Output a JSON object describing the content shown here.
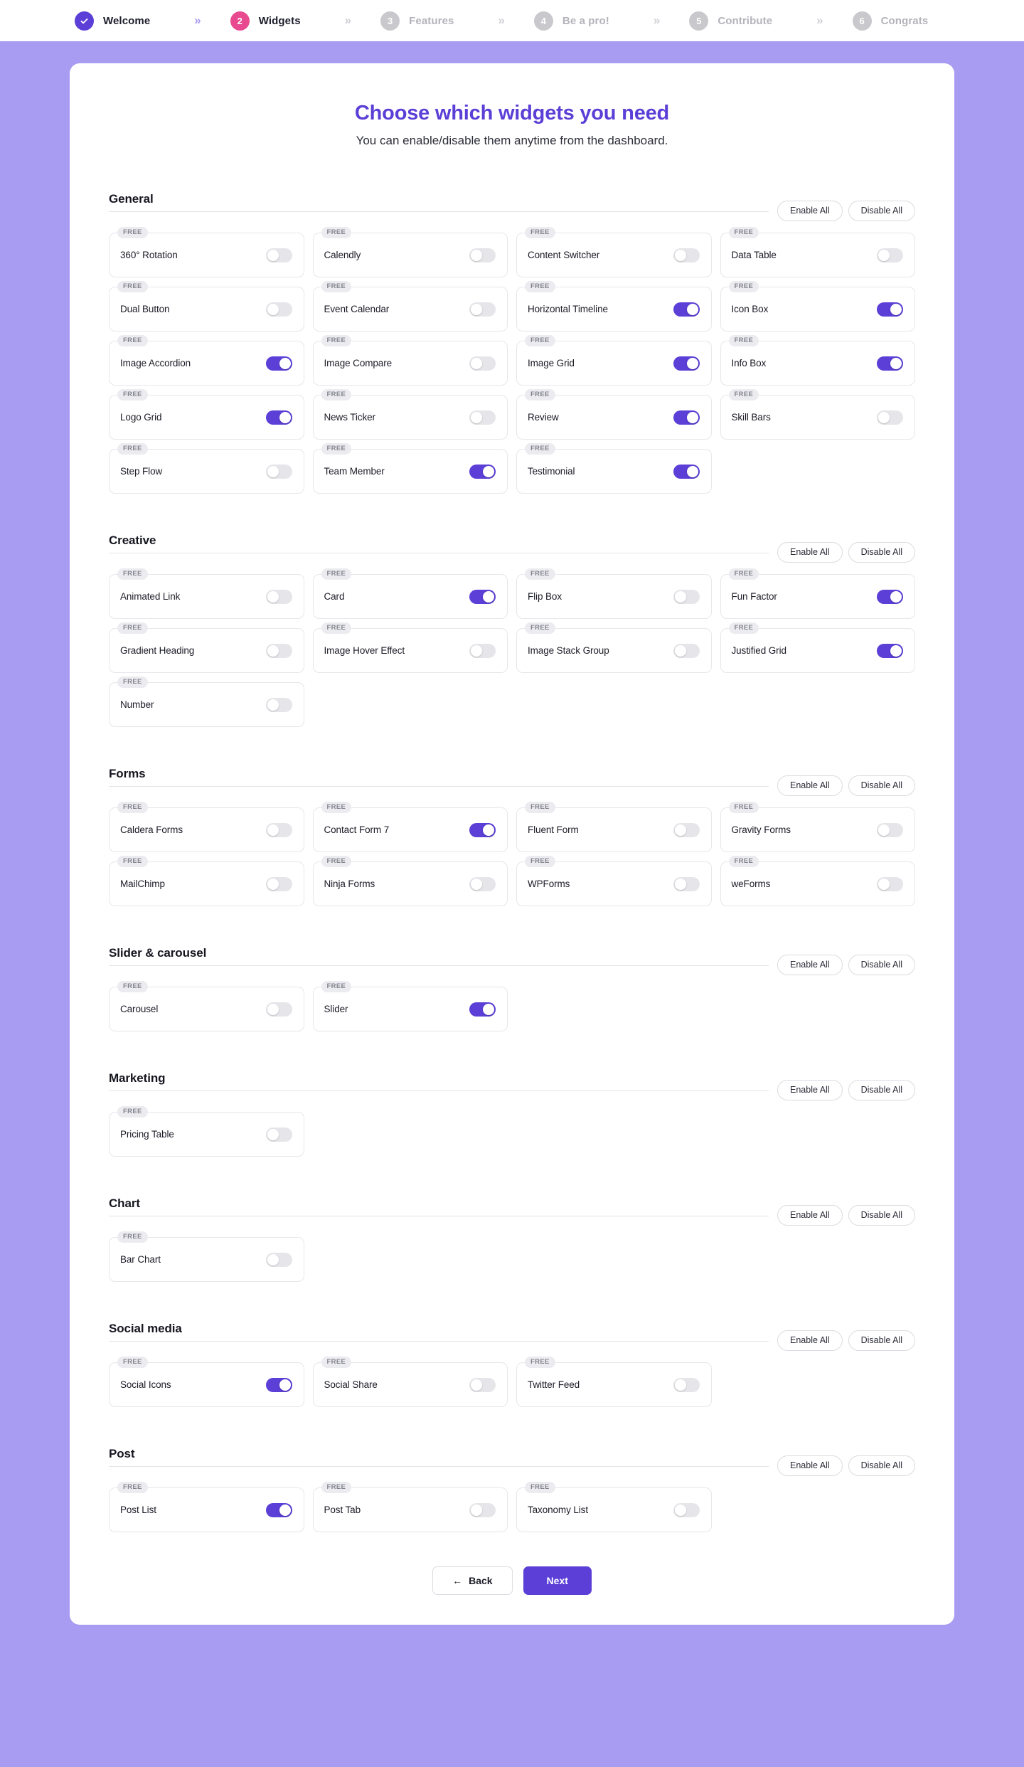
{
  "steps": [
    {
      "label": "Welcome",
      "num": "✓",
      "state": "done"
    },
    {
      "label": "Widgets",
      "num": "2",
      "state": "active"
    },
    {
      "label": "Features",
      "num": "3",
      "state": "todo"
    },
    {
      "label": "Be a pro!",
      "num": "4",
      "state": "todo"
    },
    {
      "label": "Contribute",
      "num": "5",
      "state": "todo"
    },
    {
      "label": "Congrats",
      "num": "6",
      "state": "todo"
    }
  ],
  "header": {
    "title": "Choose which widgets you need",
    "subtitle": "You can enable/disable them anytime from the dashboard."
  },
  "labels": {
    "enable_all": "Enable All",
    "disable_all": "Disable All",
    "free_badge": "FREE",
    "back": "Back",
    "back_arrow": "←",
    "next": "Next",
    "chevron": "»"
  },
  "colors": {
    "page_background": "#a79bf2",
    "panel": "#ffffff",
    "accent": "#5b3fd6",
    "active_step": "#e8498f",
    "toggle_off": "#e6e6ea",
    "card_border": "#e7e7ec",
    "badge_background": "#ececf0"
  },
  "sections": [
    {
      "title": "General",
      "widgets": [
        {
          "label": "360° Rotation",
          "enabled": false,
          "tier": "FREE"
        },
        {
          "label": "Calendly",
          "enabled": false,
          "tier": "FREE"
        },
        {
          "label": "Content Switcher",
          "enabled": false,
          "tier": "FREE"
        },
        {
          "label": "Data Table",
          "enabled": false,
          "tier": "FREE"
        },
        {
          "label": "Dual Button",
          "enabled": false,
          "tier": "FREE"
        },
        {
          "label": "Event Calendar",
          "enabled": false,
          "tier": "FREE"
        },
        {
          "label": "Horizontal Timeline",
          "enabled": true,
          "tier": "FREE"
        },
        {
          "label": "Icon Box",
          "enabled": true,
          "tier": "FREE"
        },
        {
          "label": "Image Accordion",
          "enabled": true,
          "tier": "FREE"
        },
        {
          "label": "Image Compare",
          "enabled": false,
          "tier": "FREE"
        },
        {
          "label": "Image Grid",
          "enabled": true,
          "tier": "FREE"
        },
        {
          "label": "Info Box",
          "enabled": true,
          "tier": "FREE"
        },
        {
          "label": "Logo Grid",
          "enabled": true,
          "tier": "FREE"
        },
        {
          "label": "News Ticker",
          "enabled": false,
          "tier": "FREE"
        },
        {
          "label": "Review",
          "enabled": true,
          "tier": "FREE"
        },
        {
          "label": "Skill Bars",
          "enabled": false,
          "tier": "FREE"
        },
        {
          "label": "Step Flow",
          "enabled": false,
          "tier": "FREE"
        },
        {
          "label": "Team Member",
          "enabled": true,
          "tier": "FREE"
        },
        {
          "label": "Testimonial",
          "enabled": true,
          "tier": "FREE"
        }
      ]
    },
    {
      "title": "Creative",
      "widgets": [
        {
          "label": "Animated Link",
          "enabled": false,
          "tier": "FREE"
        },
        {
          "label": "Card",
          "enabled": true,
          "tier": "FREE"
        },
        {
          "label": "Flip Box",
          "enabled": false,
          "tier": "FREE"
        },
        {
          "label": "Fun Factor",
          "enabled": true,
          "tier": "FREE"
        },
        {
          "label": "Gradient Heading",
          "enabled": false,
          "tier": "FREE"
        },
        {
          "label": "Image Hover Effect",
          "enabled": false,
          "tier": "FREE"
        },
        {
          "label": "Image Stack Group",
          "enabled": false,
          "tier": "FREE"
        },
        {
          "label": "Justified Grid",
          "enabled": true,
          "tier": "FREE"
        },
        {
          "label": "Number",
          "enabled": false,
          "tier": "FREE"
        }
      ]
    },
    {
      "title": "Forms",
      "widgets": [
        {
          "label": "Caldera Forms",
          "enabled": false,
          "tier": "FREE"
        },
        {
          "label": "Contact Form 7",
          "enabled": true,
          "tier": "FREE"
        },
        {
          "label": "Fluent Form",
          "enabled": false,
          "tier": "FREE"
        },
        {
          "label": "Gravity Forms",
          "enabled": false,
          "tier": "FREE"
        },
        {
          "label": "MailChimp",
          "enabled": false,
          "tier": "FREE"
        },
        {
          "label": "Ninja Forms",
          "enabled": false,
          "tier": "FREE"
        },
        {
          "label": "WPForms",
          "enabled": false,
          "tier": "FREE"
        },
        {
          "label": "weForms",
          "enabled": false,
          "tier": "FREE"
        }
      ]
    },
    {
      "title": "Slider & carousel",
      "widgets": [
        {
          "label": "Carousel",
          "enabled": false,
          "tier": "FREE"
        },
        {
          "label": "Slider",
          "enabled": true,
          "tier": "FREE"
        }
      ]
    },
    {
      "title": "Marketing",
      "widgets": [
        {
          "label": "Pricing Table",
          "enabled": false,
          "tier": "FREE"
        }
      ]
    },
    {
      "title": "Chart",
      "widgets": [
        {
          "label": "Bar Chart",
          "enabled": false,
          "tier": "FREE"
        }
      ]
    },
    {
      "title": "Social media",
      "widgets": [
        {
          "label": "Social Icons",
          "enabled": true,
          "tier": "FREE"
        },
        {
          "label": "Social Share",
          "enabled": false,
          "tier": "FREE"
        },
        {
          "label": "Twitter Feed",
          "enabled": false,
          "tier": "FREE"
        }
      ]
    },
    {
      "title": "Post",
      "widgets": [
        {
          "label": "Post List",
          "enabled": true,
          "tier": "FREE"
        },
        {
          "label": "Post Tab",
          "enabled": false,
          "tier": "FREE"
        },
        {
          "label": "Taxonomy List",
          "enabled": false,
          "tier": "FREE"
        }
      ]
    }
  ]
}
